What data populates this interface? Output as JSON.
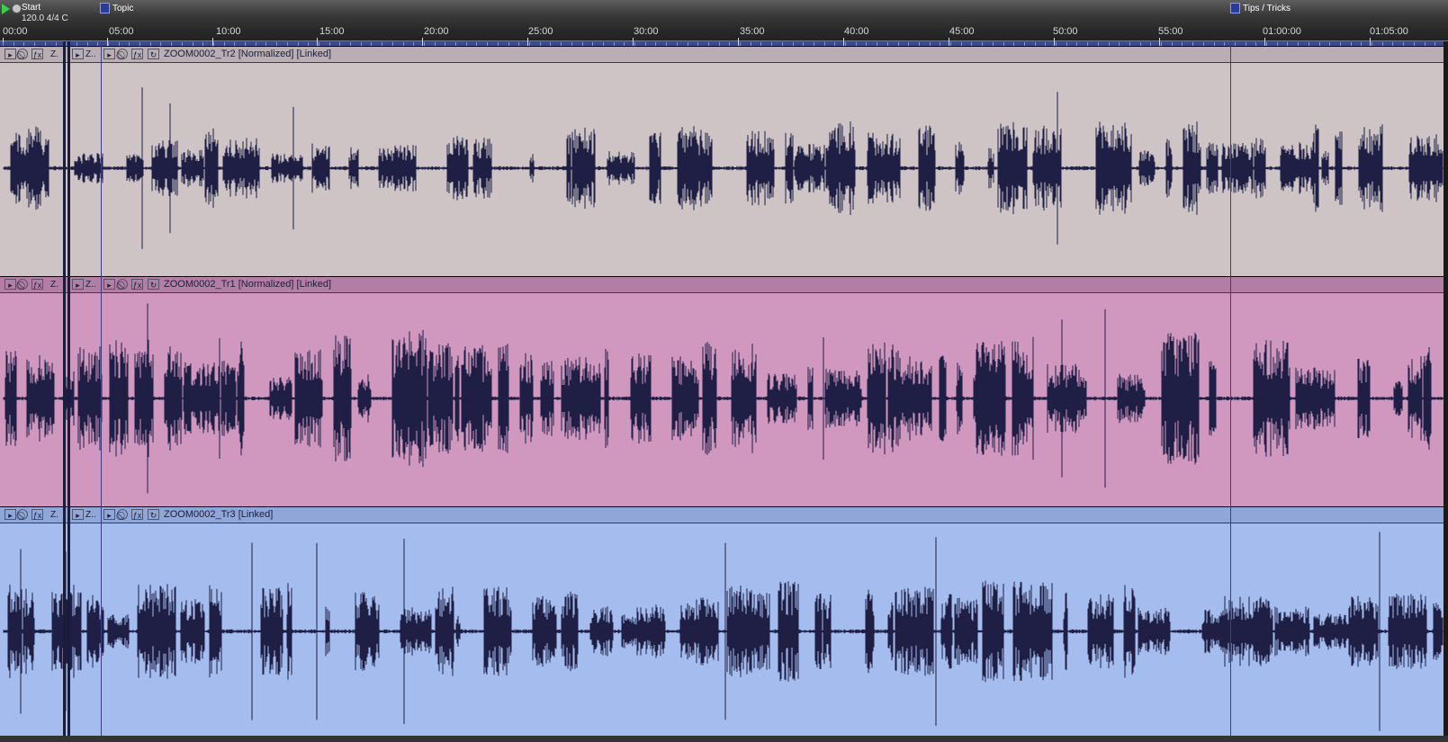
{
  "ruler": {
    "ticks": [
      "00:00",
      "05:00",
      "10:00",
      "15:00",
      "20:00",
      "25:00",
      "30:00",
      "35:00",
      "40:00",
      "45:00",
      "50:00",
      "55:00",
      "01:00:00",
      "01:05:00"
    ],
    "start_label": "Start",
    "tempo": "120.0 4/4 C",
    "markers": [
      {
        "label": "Topic"
      },
      {
        "label": "Tips / Tricks"
      }
    ]
  },
  "tracks": [
    {
      "name": "track-tr2",
      "clip_name": "ZOOM0002_Tr2 [Normalized] [Linked]",
      "short_label_1": "Z.",
      "short_label_2": "Z..",
      "bg": "#cec4c6",
      "header_bg": "#b9aeb3",
      "wave_color": "#1f1f45",
      "density": 0.55
    },
    {
      "name": "track-tr1",
      "clip_name": "ZOOM0002_Tr1 [Normalized] [Linked]",
      "short_label_1": "Z.",
      "short_label_2": "Z..",
      "bg": "#d097bf",
      "header_bg": "#b27ea3",
      "wave_color": "#1f1f45",
      "density": 0.85
    },
    {
      "name": "track-tr3",
      "clip_name": "ZOOM0002_Tr3 [Linked]",
      "short_label_1": "Z.",
      "short_label_2": "Z..",
      "bg": "#a4bcee",
      "header_bg": "#8ea6d8",
      "wave_color": "#1f1f45",
      "density": 0.6
    }
  ]
}
